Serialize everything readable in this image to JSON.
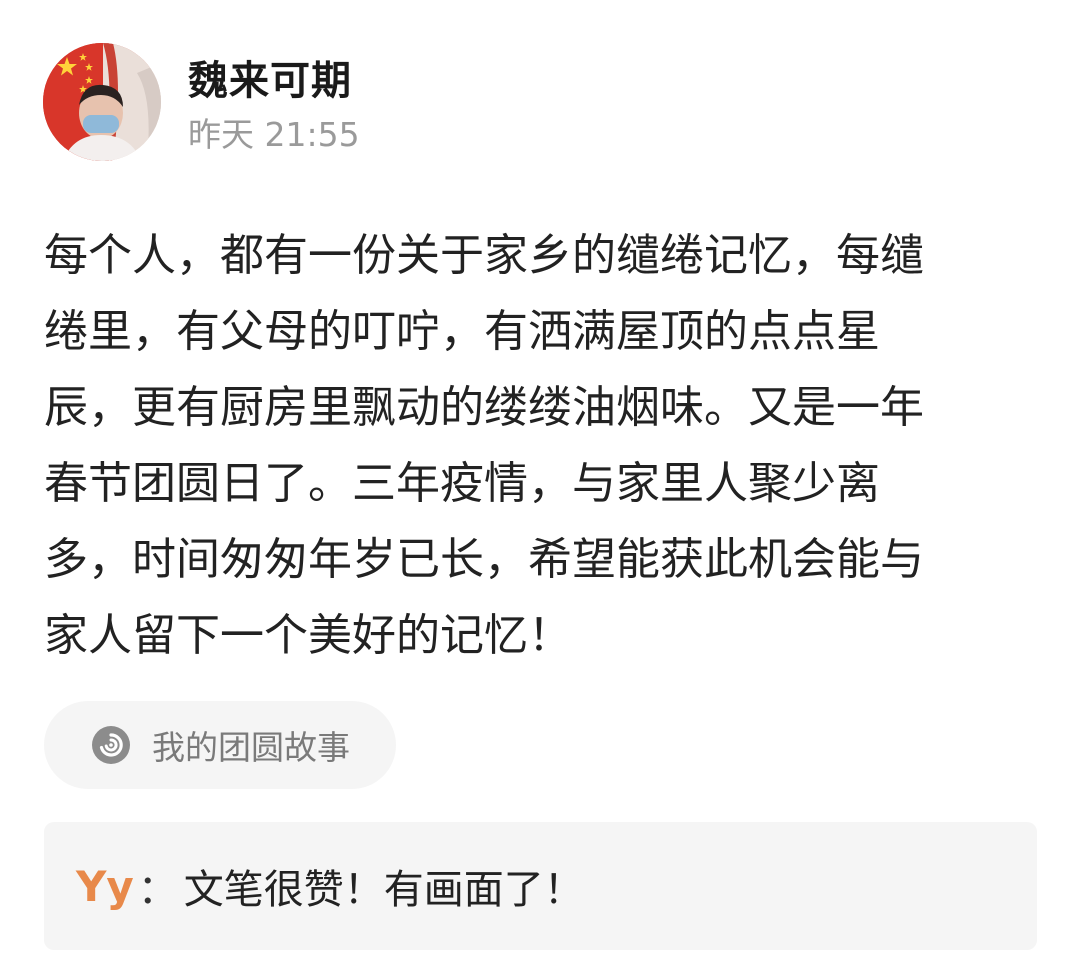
{
  "post": {
    "author": {
      "name": "魏来可期",
      "avatar_icon": "user-avatar-photo"
    },
    "timestamp": "昨天 21:55",
    "content_lines": [
      "每个人，都有一份关于家乡的缱绻记忆，每缱",
      "绻里，有父母的叮咛，有洒满屋顶的点点星",
      "辰，更有厨房里飘动的缕缕油烟味。又是一年",
      "春节团圆日了。三年疫情，与家里人聚少离",
      "多，时间匆匆年岁已长，希望能获此机会能与",
      "家人留下一个美好的记忆！"
    ],
    "topic": {
      "icon": "topic-swirl-icon",
      "label": "我的团圆故事"
    }
  },
  "comment": {
    "author": "Yy",
    "separator": "：",
    "text": "文笔很赞！有画面了！"
  },
  "colors": {
    "background": "#ffffff",
    "username": "#1a1a1a",
    "timestamp": "#9a9a9a",
    "body_text": "#222222",
    "pill_bg": "#f5f5f5",
    "topic_text": "#7a7a7a",
    "comment_author": "#e8894a"
  }
}
